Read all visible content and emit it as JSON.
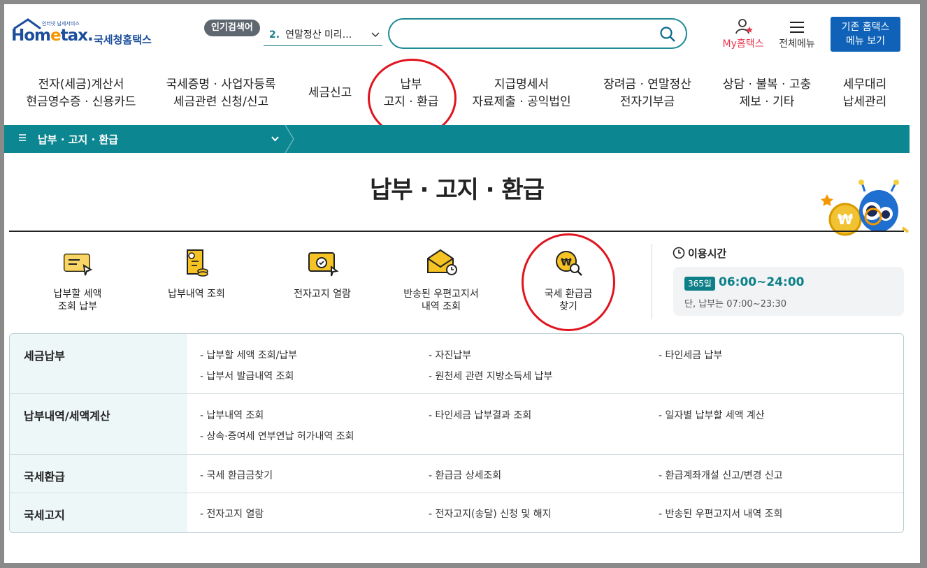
{
  "header": {
    "logo_text": "Hometax.",
    "logo_sub": "인터넷 납세서비스",
    "logo_name": "국세청홈택스",
    "popular_badge": "인기검색어",
    "popular_num": "2.",
    "popular_term": "연말정산 미리...",
    "search_placeholder": "",
    "myhome_label": "My홈택스",
    "allmenu_label": "전체메뉴",
    "legacy_line1": "기존 홈택스",
    "legacy_line2": "메뉴 보기"
  },
  "gnb": [
    {
      "line1": "전자(세금)계산서",
      "line2": "현금영수증 · 신용카드"
    },
    {
      "line1": "국세증명 · 사업자등록",
      "line2": "세금관련 신청/신고"
    },
    {
      "line1": "세금신고",
      "line2": ""
    },
    {
      "line1": "납부",
      "line2": "고지 · 환급"
    },
    {
      "line1": "지급명세서",
      "line2": "자료제출 · 공익법인"
    },
    {
      "line1": "장려금 · 연말정산",
      "line2": "전자기부금"
    },
    {
      "line1": "상담 · 불복 · 고충",
      "line2": "제보 · 기타"
    },
    {
      "line1": "세무대리",
      "line2": "납세관리"
    }
  ],
  "breadcrumb": {
    "label": "납부 · 고지 · 환급"
  },
  "page_title": "납부 · 고지 · 환급",
  "quick_menu": [
    {
      "line1": "납부할 세액",
      "line2": "조회 납부",
      "icon": "tax-payment-icon"
    },
    {
      "line1": "납부내역 조회",
      "line2": "",
      "icon": "payment-history-icon"
    },
    {
      "line1": "전자고지 열람",
      "line2": "",
      "icon": "e-notice-icon"
    },
    {
      "line1": "반송된 우편고지서",
      "line2": "내역 조회",
      "icon": "returned-mail-icon"
    },
    {
      "line1": "국세 환급금",
      "line2": "찾기",
      "icon": "refund-search-icon"
    }
  ],
  "hours": {
    "title": "이용시간",
    "badge": "365일",
    "time": "06:00~24:00",
    "note": "단, 납부는 07:00~23:30"
  },
  "sections": [
    {
      "title": "세금납부",
      "links": [
        "납부할 세액 조회/납부",
        "자진납부",
        "타인세금 납부",
        "납부서 발급내역 조회",
        "원천세 관련 지방소득세 납부"
      ]
    },
    {
      "title": "납부내역/세액계산",
      "links": [
        "납부내역 조회",
        "타인세금 납부결과 조회",
        "일자별 납부할 세액 계산",
        "상속·증여세 연부연납 허가내역 조회"
      ]
    },
    {
      "title": "국세환급",
      "links": [
        "국세 환급금찾기",
        "환급금 상세조회",
        "환급계좌개설 신고/변경 신고"
      ]
    },
    {
      "title": "국세고지",
      "links": [
        "전자고지 열람",
        "전자고지(송달) 신청 및 해지",
        "반송된 우편고지서 내역 조회"
      ]
    }
  ],
  "colors": {
    "brand_teal": "#0c8690",
    "brand_blue": "#1c4e9c",
    "accent_red": "#e0141e",
    "legacy_btn": "#0f62b8"
  }
}
